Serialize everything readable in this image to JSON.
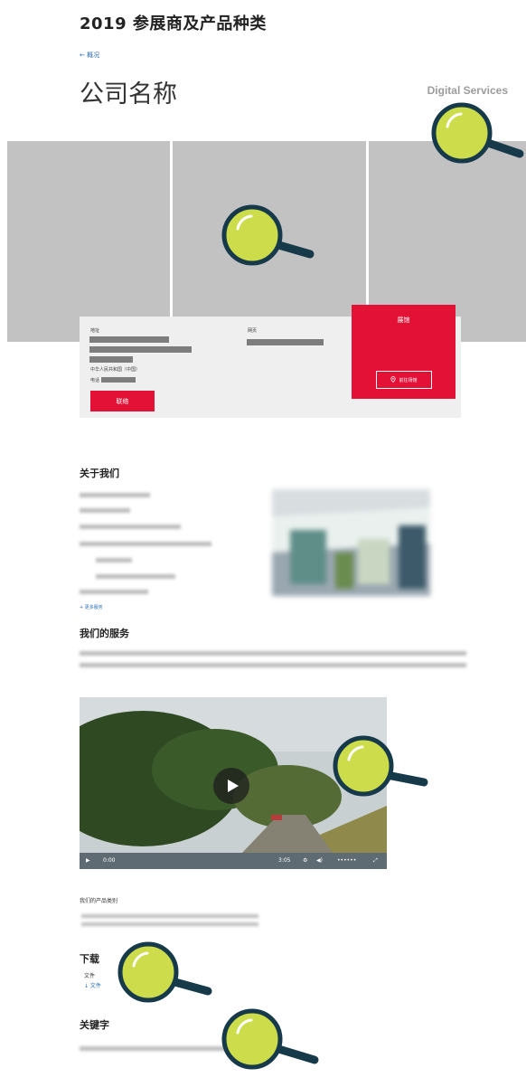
{
  "header": {
    "title": "2019 参展商及产品种类",
    "back": "← 概况",
    "company": "公司名称",
    "category": "Digital Services"
  },
  "contact": {
    "address_label": "地址",
    "web_label": "网页",
    "country": "中华人民共和国（中国）",
    "phone_label": "电话",
    "contact_button": "联络"
  },
  "hall": {
    "title": "展馆",
    "map_button": "前往场馆"
  },
  "about": {
    "heading": "关于我们",
    "more": "+ 更多服务"
  },
  "services": {
    "heading": "我们的服务"
  },
  "video": {
    "time_current": "0:00",
    "time_total": "3:05"
  },
  "products": {
    "label": "我们的产品类别"
  },
  "downloads": {
    "heading": "下载",
    "file_label": "文件",
    "file_link": "↓ 文件"
  },
  "keywords": {
    "heading": "关键字"
  },
  "colors": {
    "accent": "#e31136",
    "gallery": "#c2c2c2",
    "magnifier_lens": "#cddc4a",
    "magnifier_rim": "#173a4b"
  }
}
